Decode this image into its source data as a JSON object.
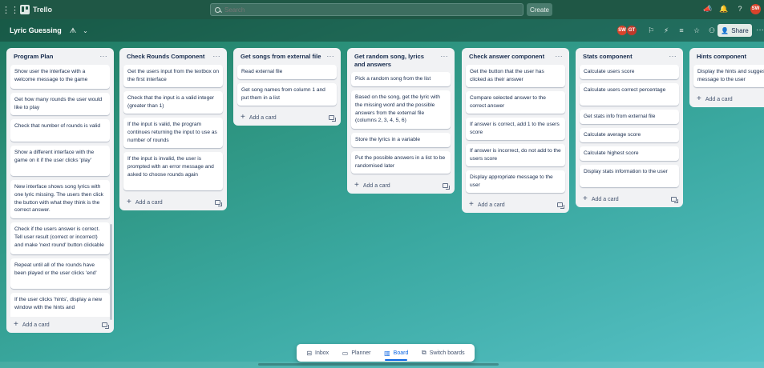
{
  "app": {
    "name": "Trello"
  },
  "search": {
    "placeholder": "Search"
  },
  "topbar": {
    "create_label": "Create",
    "avatar_initials": "SW"
  },
  "board": {
    "title": "Lyric Guessing",
    "type_label": "ᗑ",
    "share_label": "Share"
  },
  "members": [
    {
      "initials": "SW"
    },
    {
      "initials": "GT"
    }
  ],
  "add_card_label": "Add a card",
  "lists": [
    {
      "title": "Program Plan",
      "cards": [
        "Show user the interface with a welcome message to the game",
        "Get how many rounds the user would like to play",
        "Check that number of rounds is valid",
        "Show a different interface with the game on it if the user clicks 'play'",
        "New interface shows song lyrics with one lyric missing. The users then click the button with what they think is the correct answer.",
        "Check if the users answer is correct. Tell user result (correct or incorrect) and make 'next round' button clickable",
        "Repeat until all of the rounds have been played or the user clicks 'end'",
        "If the user clicks 'hints', display a new window with the hints and"
      ]
    },
    {
      "title": "Check Rounds Component",
      "cards": [
        "Get the users input from the textbox on the first interface",
        "Check that the input is a valid integer (greater than 1)",
        "If the input is valid, the program continues returning the input to use as number of rounds",
        "If the input is invalid, the user is prompted with an error message and asked to choose rounds again"
      ]
    },
    {
      "title": "Get songs from external file",
      "cards": [
        "Read external file",
        "Get song names from column 1 and put them in a list"
      ]
    },
    {
      "title": "Get random song, lyrics and answers",
      "cards": [
        "Pick a random song from the list",
        "Based on the song, get the lyric with the missing word and the possible answers from the external file (columns 2, 3, 4, 5, 6)",
        "Store the lyrics in a variable",
        "Put the possible answers in a list to be randomised later"
      ]
    },
    {
      "title": "Check answer component",
      "cards": [
        "Get the button that the user has clicked as their answer",
        "Compare selected answer to the correct answer",
        "If answer is correct, add 1 to the users score",
        "If answer is incorrect, do not add to the users score",
        "Display appropriate message to the user"
      ]
    },
    {
      "title": "Stats component",
      "cards": [
        "Calculate users score",
        "Calculate users correct percentage",
        "Get stats info from external file",
        "Calculate average score",
        "Calculate highest score",
        "Display stats information to the user"
      ]
    },
    {
      "title": "Hints component",
      "cards": [
        "Display the hints and suggestions message to the user"
      ]
    }
  ],
  "bottom_nav": [
    {
      "label": "Inbox",
      "icon": "inbox-icon"
    },
    {
      "label": "Planner",
      "icon": "calendar-icon"
    },
    {
      "label": "Board",
      "icon": "board-icon",
      "active": true
    },
    {
      "label": "Switch boards",
      "icon": "switch-boards-icon"
    }
  ],
  "colors": {
    "topbar": "#1f5745",
    "accent": "#0c66e4",
    "avatar": "#d9432b"
  }
}
